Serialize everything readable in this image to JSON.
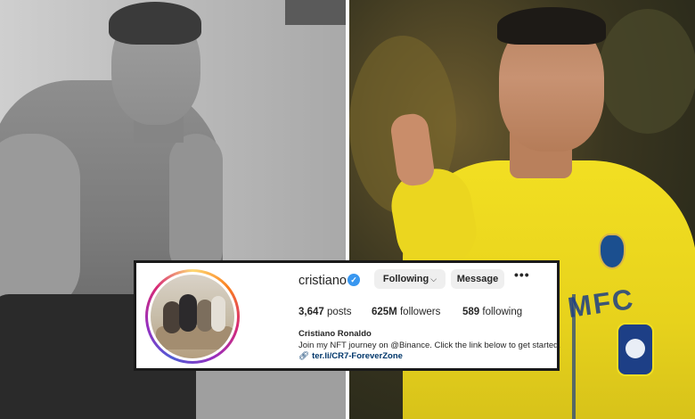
{
  "profile": {
    "username": "cristiano",
    "verified": true,
    "buttons": {
      "following": "Following",
      "message": "Message",
      "more": "•••"
    },
    "stats": {
      "posts_count": "3,647",
      "posts_label": "posts",
      "followers_count": "625M",
      "followers_label": "followers",
      "following_count": "589",
      "following_label": "following"
    },
    "full_name": "Cristiano Ronaldo",
    "bio": "Join my NFT journey on @Binance. Click the link below to get started.",
    "link": "ter.li/CR7-ForeverZone"
  },
  "photos": {
    "right_jersey_text": "MFC"
  },
  "colors": {
    "verified_blue": "#3897f0",
    "button_bg": "#efefef",
    "link_blue": "#00376b",
    "jersey_yellow": "#f2df22"
  }
}
